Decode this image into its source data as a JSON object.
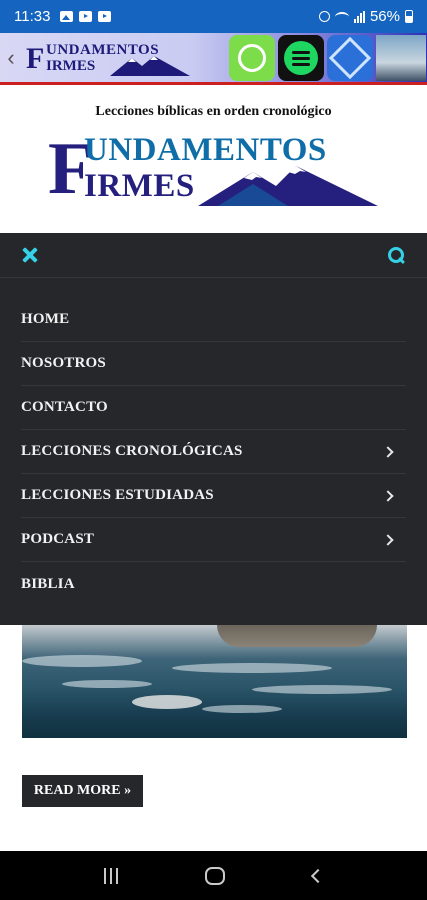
{
  "status_bar": {
    "time": "11:33",
    "battery": "56%",
    "icons": [
      "image-icon",
      "youtube-icon",
      "youtube-icon",
      "alarm-icon",
      "wifi-icon",
      "signal-icon",
      "battery-icon"
    ]
  },
  "banner": {
    "logo_text_line1": "UNDAMENTOS",
    "logo_text_line2": "IRMES",
    "logo_initial": "F",
    "apps": [
      "chat-app-icon",
      "spotify-icon",
      "cube-app-icon",
      "photo-thumbnail"
    ]
  },
  "header": {
    "tagline": "Lecciones bíblicas en orden cronológico",
    "logo_initial": "F",
    "logo_line1": "UNDAMENTOS",
    "logo_line2": "IRMES"
  },
  "menu": {
    "items": [
      {
        "label": "HOME",
        "has_submenu": false
      },
      {
        "label": "NOSOTROS",
        "has_submenu": false
      },
      {
        "label": "CONTACTO",
        "has_submenu": false
      },
      {
        "label": "LECCIONES CRONOLÓGICAS",
        "has_submenu": true
      },
      {
        "label": "LECCIONES ESTUDIADAS",
        "has_submenu": true
      },
      {
        "label": "PODCAST",
        "has_submenu": true
      },
      {
        "label": "BIBLIA",
        "has_submenu": false
      }
    ]
  },
  "post": {
    "read_more_label": "READ MORE »"
  },
  "colors": {
    "status_bar": "#1565c0",
    "menu_bg": "#25272b",
    "accent": "#35d1e6",
    "logo_dark": "#25207e",
    "logo_blue": "#0f6ea8"
  }
}
